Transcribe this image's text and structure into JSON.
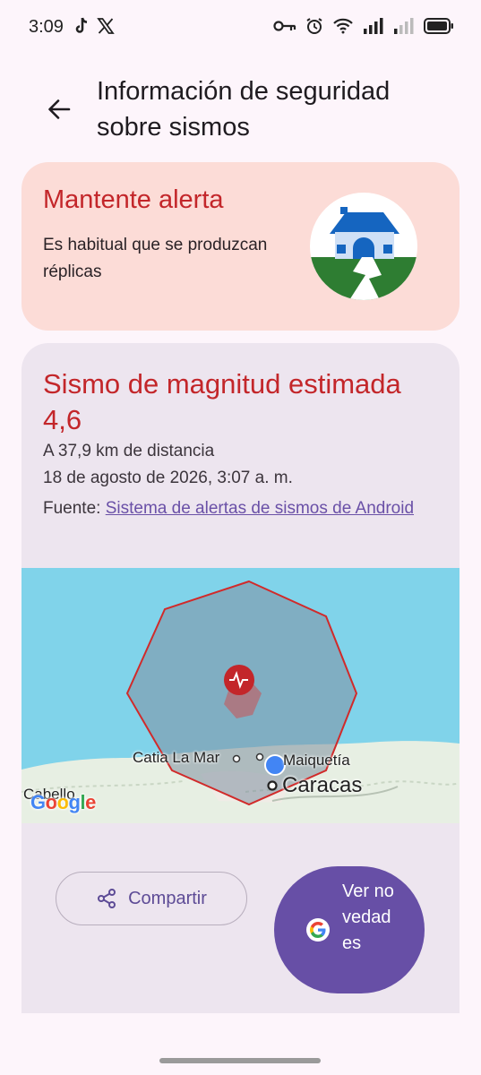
{
  "status_bar": {
    "time": "3:09",
    "icons": [
      "tiktok-icon",
      "x-icon",
      "key-icon",
      "alarm-icon",
      "wifi-icon",
      "signal-icon",
      "signal-icon",
      "battery-icon"
    ]
  },
  "header": {
    "title": "Información de seguridad sobre sismos",
    "back_icon": "arrow-back-icon"
  },
  "alert_card": {
    "title": "Mantente alerta",
    "text": "Es habitual que se produzcan réplicas",
    "illustration": "house-quake-icon",
    "colors": {
      "background": "#fcdcd7",
      "title": "#c3262a"
    }
  },
  "quake_card": {
    "title": "Sismo de magnitud estimada 4,6",
    "distance": "A 37,9 km de distancia",
    "datetime": "18 de agosto de 2026, 3:07 a. m.",
    "source_prefix": "Fuente:",
    "source_link": "Sistema de alertas de sismos de Android"
  },
  "map": {
    "labels": {
      "catia": "Catia La Mar",
      "maiquetia": "Maiquetía",
      "caracas": "Caracas",
      "cabello": "Cabello"
    },
    "logo": "Google",
    "epicenter_icon": "seismograph-icon",
    "location_icon": "my-location-dot",
    "colors": {
      "sea": "#80d3ea",
      "land": "#e7efe3",
      "zone": "#c3262a"
    }
  },
  "actions": {
    "share_label": "Compartir",
    "news_label": "Ver novedades",
    "colors": {
      "primary": "#674fa6"
    }
  }
}
